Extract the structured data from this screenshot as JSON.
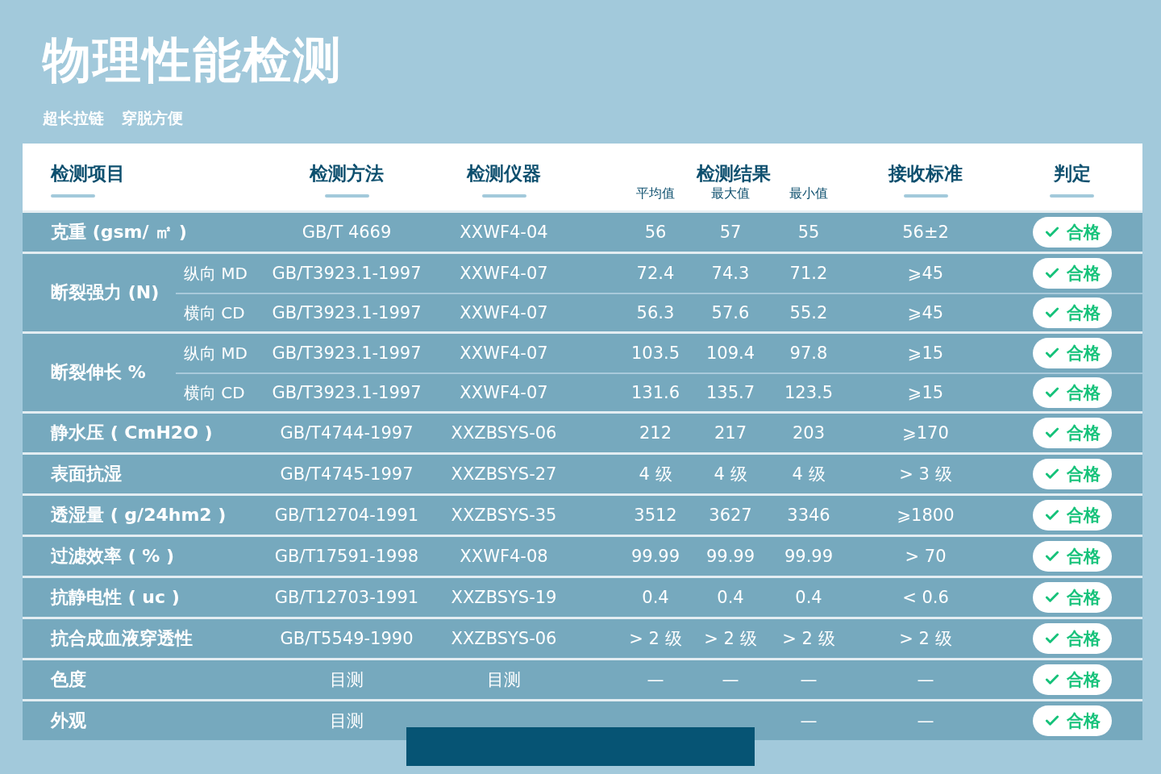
{
  "title": "物理性能检测",
  "subtitle": [
    "超长拉链",
    "穿脱方便"
  ],
  "table": {
    "columns": [
      {
        "label": "检测项目",
        "underline": true
      },
      {
        "label": "检测方法",
        "underline": true
      },
      {
        "label": "检测仪器",
        "underline": true
      },
      {
        "label": "检测结果",
        "underline": false,
        "sub_labels": [
          "平均值",
          "最大值",
          "最小值"
        ]
      },
      {
        "label": "接收标准",
        "underline": true
      },
      {
        "label": "判定",
        "underline": true
      }
    ],
    "groups": [
      {
        "item": "克重 (gsm/ ㎡ )",
        "rows": [
          {
            "method": "GB/T 4669",
            "instrument": "XXWF4-04",
            "avg": "56",
            "max": "57",
            "min": "55",
            "standard": "56±2",
            "verdict": "合格"
          }
        ]
      },
      {
        "item": "断裂强力 (N)",
        "rows": [
          {
            "direction": "纵向 MD",
            "method": "GB/T3923.1-1997",
            "instrument": "XXWF4-07",
            "avg": "72.4",
            "max": "74.3",
            "min": "71.2",
            "standard": "⩾45",
            "verdict": "合格"
          },
          {
            "direction": "横向 CD",
            "method": "GB/T3923.1-1997",
            "instrument": "XXWF4-07",
            "avg": "56.3",
            "max": "57.6",
            "min": "55.2",
            "standard": "⩾45",
            "verdict": "合格"
          }
        ]
      },
      {
        "item": "断裂伸长 %",
        "rows": [
          {
            "direction": "纵向 MD",
            "method": "GB/T3923.1-1997",
            "instrument": "XXWF4-07",
            "avg": "103.5",
            "max": "109.4",
            "min": "97.8",
            "standard": "⩾15",
            "verdict": "合格"
          },
          {
            "direction": "横向 CD",
            "method": "GB/T3923.1-1997",
            "instrument": "XXWF4-07",
            "avg": "131.6",
            "max": "135.7",
            "min": "123.5",
            "standard": "⩾15",
            "verdict": "合格"
          }
        ]
      },
      {
        "item": "静水压 ( CmH2O )",
        "rows": [
          {
            "method": "GB/T4744-1997",
            "instrument": "XXZBSYS-06",
            "avg": "212",
            "max": "217",
            "min": "203",
            "standard": "⩾170",
            "verdict": "合格"
          }
        ]
      },
      {
        "item": "表面抗湿",
        "rows": [
          {
            "method": "GB/T4745-1997",
            "instrument": "XXZBSYS-27",
            "avg": "4 级",
            "max": "4 级",
            "min": "4 级",
            "standard": "> 3 级",
            "verdict": "合格"
          }
        ]
      },
      {
        "item": "透湿量 ( g/24hm2 )",
        "rows": [
          {
            "method": "GB/T12704-1991",
            "instrument": "XXZBSYS-35",
            "avg": "3512",
            "max": "3627",
            "min": "3346",
            "standard": "⩾1800",
            "verdict": "合格"
          }
        ]
      },
      {
        "item": "过滤效率 ( % )",
        "rows": [
          {
            "method": "GB/T17591-1998",
            "instrument": "XXWF4-08",
            "avg": "99.99",
            "max": "99.99",
            "min": "99.99",
            "standard": "> 70",
            "verdict": "合格"
          }
        ]
      },
      {
        "item": "抗静电性 ( uc )",
        "rows": [
          {
            "method": "GB/T12703-1991",
            "instrument": "XXZBSYS-19",
            "avg": "0.4",
            "max": "0.4",
            "min": "0.4",
            "standard": "< 0.6",
            "verdict": "合格"
          }
        ]
      },
      {
        "item": "抗合成血液穿透性",
        "rows": [
          {
            "method": "GB/T5549-1990",
            "instrument": "XXZBSYS-06",
            "avg": "> 2 级",
            "max": "> 2 级",
            "min": "> 2 级",
            "standard": "> 2 级",
            "verdict": "合格"
          }
        ]
      },
      {
        "item": "色度",
        "rows": [
          {
            "method": "目测",
            "instrument": "目测",
            "avg": "—",
            "max": "—",
            "min": "—",
            "standard": "—",
            "verdict": "合格"
          }
        ]
      },
      {
        "item": "外观",
        "rows": [
          {
            "method": "目测",
            "min": "—",
            "standard": "—",
            "verdict": "合格"
          }
        ]
      }
    ]
  }
}
